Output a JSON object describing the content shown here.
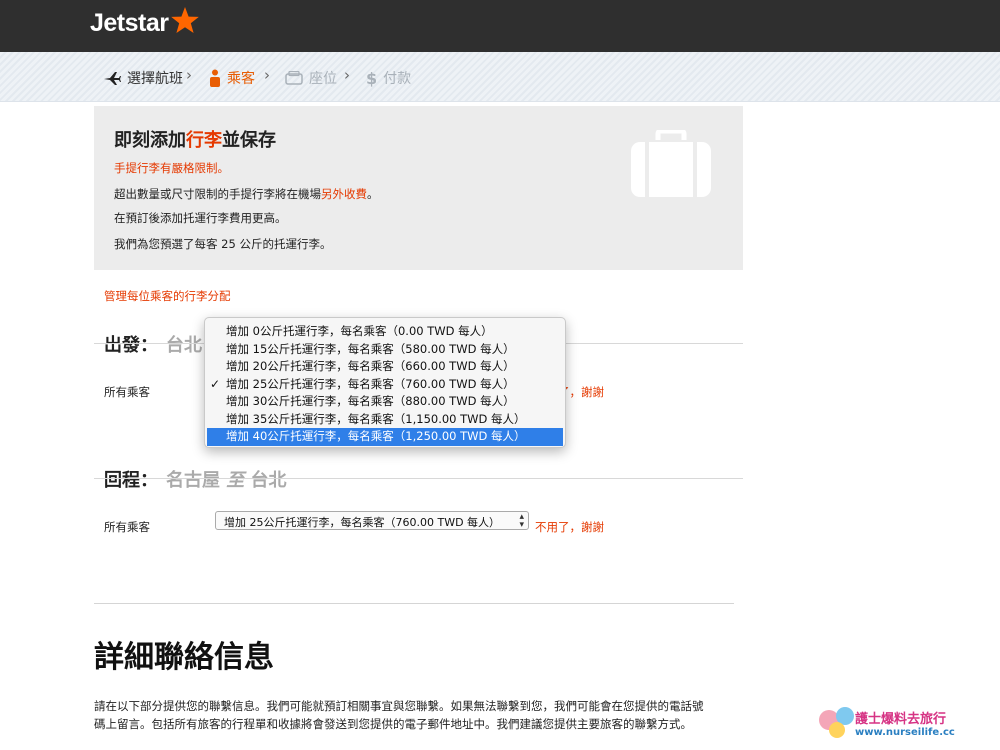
{
  "header": {
    "logo_text": "Jetstar",
    "brand_color": "#ff6600"
  },
  "steps": [
    {
      "label": "選擇航班",
      "icon": "plane-icon",
      "state": "done"
    },
    {
      "label": "乘客",
      "icon": "person-icon",
      "state": "active"
    },
    {
      "label": "座位",
      "icon": "seat-icon",
      "state": "disabled"
    },
    {
      "label": "付款",
      "icon": "dollar-icon",
      "state": "disabled"
    }
  ],
  "promo": {
    "title_pre": "即刻添加",
    "title_highlight": "行李",
    "title_post": "並保存",
    "line1": "手提行李有嚴格限制。",
    "line2_pre": "超出數量或尺寸限制的手提行李將在機場",
    "line2_highlight": "另外收費",
    "line2_post": "。",
    "line3": "在預訂後添加托運行李費用更高。",
    "line4": "我們為您預選了每客 25 公斤的托運行李。"
  },
  "manage_link": "管理每位乘客的行李分配",
  "departure": {
    "label": "出發：",
    "route": "台北",
    "passengers_label": "所有乘客",
    "decline": "不用了，謝謝"
  },
  "return": {
    "label": "回程：",
    "from": "名古屋",
    "to_word": "至",
    "to": "台北",
    "passengers_label": "所有乘客",
    "selected_value": "增加 25公斤托運行李，每名乘客（760.00 TWD 每人）",
    "decline": "不用了，謝謝"
  },
  "dropdown_options": [
    {
      "label": "增加 0公斤托運行李，每名乘客（0.00 TWD 每人）",
      "checked": false,
      "highlighted": false
    },
    {
      "label": "增加 15公斤托運行李，每名乘客（580.00 TWD 每人）",
      "checked": false,
      "highlighted": false
    },
    {
      "label": "增加 20公斤托運行李，每名乘客（660.00 TWD 每人）",
      "checked": false,
      "highlighted": false
    },
    {
      "label": "增加 25公斤托運行李，每名乘客（760.00 TWD 每人）",
      "checked": true,
      "highlighted": false
    },
    {
      "label": "增加 30公斤托運行李，每名乘客（880.00 TWD 每人）",
      "checked": false,
      "highlighted": false
    },
    {
      "label": "增加 35公斤托運行李，每名乘客（1,150.00 TWD 每人）",
      "checked": false,
      "highlighted": false
    },
    {
      "label": "增加 40公斤托運行李，每名乘客（1,250.00 TWD 每人）",
      "checked": false,
      "highlighted": true
    }
  ],
  "contact": {
    "title": "詳細聯絡信息",
    "body": "請在以下部分提供您的聯繫信息。我們可能就預訂相關事宜與您聯繫。如果無法聯繫到您，我們可能會在您提供的電話號碼上留言。包括所有旅客的行程單和收據將會發送到您提供的電子郵件地址中。我們建議您提供主要旅客的聯繫方式。"
  },
  "watermark": {
    "text": "護士爆料去旅行",
    "url_text": "www.nurseilife.cc"
  },
  "colors": {
    "accent": "#e53900",
    "highlight_blue": "#2f7fe8",
    "header_bg": "#2f2f2f"
  }
}
